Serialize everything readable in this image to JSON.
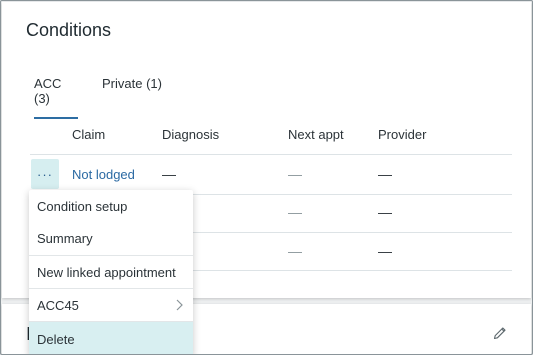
{
  "conditions_card": {
    "title": "Conditions",
    "tabs": [
      {
        "label": "ACC (3)",
        "active": true
      },
      {
        "label": "Private (1)",
        "active": false
      }
    ],
    "columns": [
      "Claim",
      "Diagnosis",
      "Next appt",
      "Provider"
    ],
    "rows": [
      {
        "claim": "Not lodged",
        "diagnosis": "—",
        "next_appt": "—",
        "provider": "—"
      },
      {
        "claim": "",
        "diagnosis": "",
        "next_appt": "—",
        "provider": "—"
      },
      {
        "claim": "",
        "diagnosis": "",
        "next_appt": "—",
        "provider": "—"
      }
    ],
    "more_button": "···"
  },
  "second_card": {
    "title": "I"
  },
  "context_menu": {
    "items": [
      {
        "label": "Condition setup"
      },
      {
        "label": "Summary"
      },
      {
        "label": "New linked appointment"
      },
      {
        "label": "ACC45",
        "has_submenu": true
      },
      {
        "label": "Delete",
        "selected": true
      }
    ]
  },
  "colors": {
    "accent": "#2d6da3",
    "link": "#2b6aa3",
    "highlight": "#d8eff1"
  }
}
